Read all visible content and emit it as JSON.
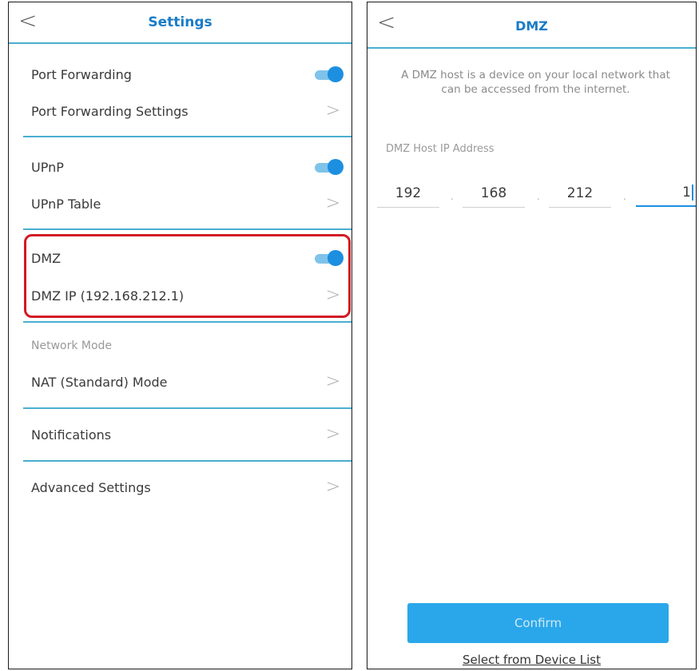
{
  "settings": {
    "title": "Settings",
    "back_icon": "<",
    "port_forwarding": {
      "label": "Port Forwarding",
      "enabled": true
    },
    "port_forwarding_settings": "Port Forwarding Settings",
    "upnp": {
      "label": "UPnP",
      "enabled": true
    },
    "upnp_table": "UPnP Table",
    "dmz": {
      "label": "DMZ",
      "enabled": true
    },
    "dmz_ip": "DMZ IP (192.168.212.1)",
    "network_mode_section": "Network Mode",
    "nat_mode": "NAT (Standard) Mode",
    "notifications": "Notifications",
    "advanced_settings": "Advanced Settings",
    "chevron": ">",
    "highlight_color": "#d21a24"
  },
  "dmz_page": {
    "title": "DMZ",
    "back_icon": "<",
    "description": "A DMZ host is a device on your local network that can be accessed from the internet.",
    "field_label": "DMZ Host IP Address",
    "ip": [
      "192",
      "168",
      "212",
      "1"
    ],
    "separator": ".",
    "confirm_label": "Confirm",
    "select_link": "Select from Device List"
  },
  "colors": {
    "accent": "#1a7cc8",
    "toggle_on": "#1c8fe0",
    "divider": "#4aaed0",
    "button": "#2aa7ea"
  }
}
